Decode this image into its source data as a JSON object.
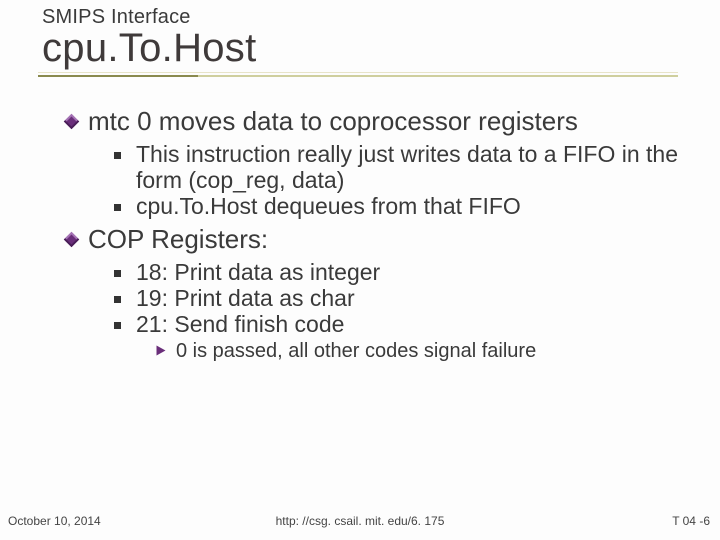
{
  "header": {
    "subtitle": "SMIPS Interface",
    "title": "cpu.To.Host"
  },
  "bullets": {
    "b1": "mtc 0 moves data to coprocessor registers",
    "b1s1": "This instruction really just writes data to a FIFO in the form (cop_reg, data)",
    "b1s2": "cpu.To.Host dequeues from that FIFO",
    "b2": "COP Registers:",
    "b2s1": "18: Print data as integer",
    "b2s2": "19: Print data as char",
    "b2s3": "21: Send finish code",
    "b2s3a": "0 is passed, all other codes signal failure"
  },
  "footer": {
    "date": "October 10, 2014",
    "url": "http: //csg. csail. mit. edu/6. 175",
    "page": "T 04 -6"
  }
}
